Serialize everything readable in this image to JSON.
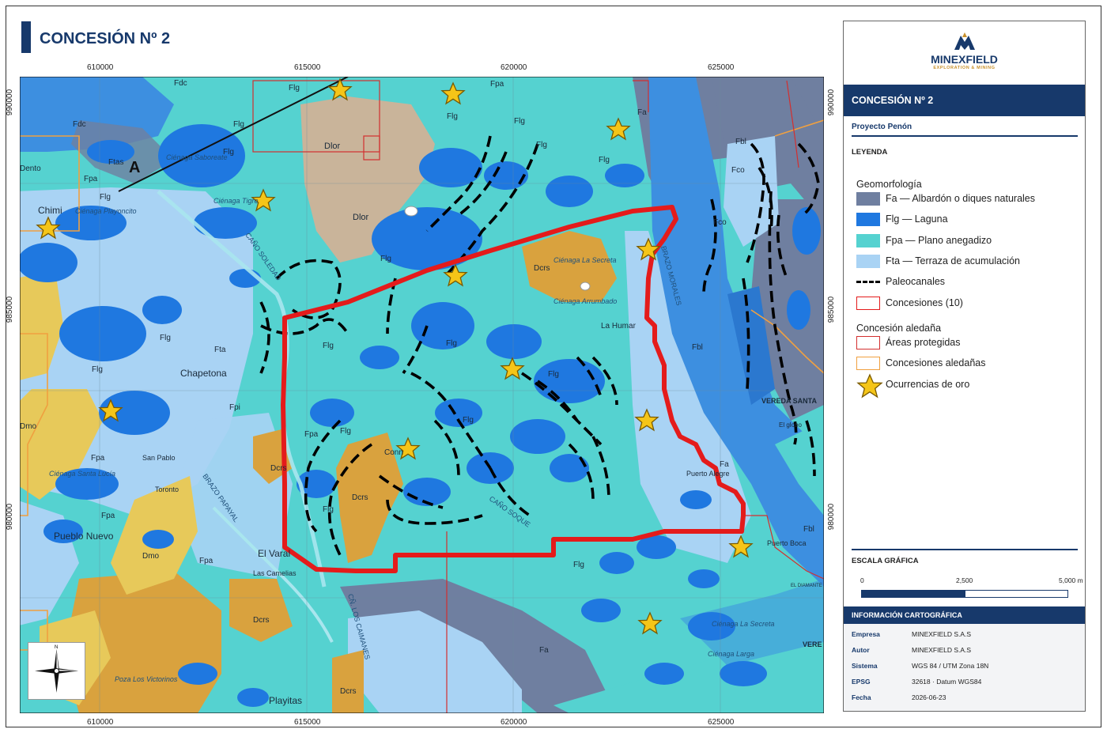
{
  "title": "CONCESIÓN Nº 2",
  "coords": {
    "x_ticks": [
      "610000",
      "615000",
      "620000",
      "625000"
    ],
    "y_ticks": [
      "990000",
      "985000",
      "980000"
    ]
  },
  "colors": {
    "fa": "#6f7fa0",
    "flg": "#1f78e0",
    "fpa": "#55d2d0",
    "fta": "#a9d3f4",
    "dlor": "#c9b49a",
    "dcrs": "#d9a23e",
    "dmo": "#e7c95a",
    "river": "#3d8fe0",
    "concession": "#e41b1b",
    "protected": "#d32f2f",
    "neighbor": "#f0a040",
    "star": "#f5c518",
    "brand": "#17396b",
    "brand_accent": "#c8912c"
  },
  "map_labels": {
    "fdc1": "Fdc",
    "fdc2": "Fdc",
    "a_label": "A",
    "ftas": "Ftas",
    "fpa_nw": "Fpa",
    "dento": "Dento",
    "chimi": "Chimi",
    "cienaga_playoncito": "Ciénaga Playoncito",
    "cienaga_saboreate": "Ciénaga Saboreate",
    "cienaga_tigre": "Ciénaga Tigre",
    "cano_soledad": "CAÑO SOLEDAD",
    "dlor1": "Dlor",
    "dlor2": "Dlor",
    "flg_a": "Flg",
    "flg_b": "Flg",
    "flg_c": "Flg",
    "flg_d": "Flg",
    "flg_e": "Flg",
    "flg_f": "Flg",
    "flg_g": "Flg",
    "flg_h": "Flg",
    "flg_i": "Flg",
    "flg_j": "Flg",
    "flg_k": "Flg",
    "flg_l": "Flg",
    "flg_m": "Flg",
    "flg_n": "Flg",
    "flg_o": "Flg",
    "flg_p": "Flg",
    "flg_q": "Flg",
    "flg_r": "Flg",
    "fpa_top": "Fpa",
    "fa_top": "Fa",
    "fbl1": "Fbl",
    "fco1": "Fco",
    "fco2": "Fco",
    "fbl2": "Fbl",
    "fbl3": "Fbl",
    "dcrs1": "Dcrs",
    "cienaga_secreta": "Ciénaga La Secreta",
    "cienaga_arrumbado": "Ciénaga Arrumbado",
    "la_humareda": "La Humar",
    "fta1": "Fta",
    "chapetona": "Chapetona",
    "fpi": "Fpi",
    "cienaga_santa_lucia": "Ciénaga Santa Lucía",
    "san_pablo": "San Pablo",
    "dmo1": "Dmo",
    "dmo2": "Dmo",
    "dcrs2": "Dcrs",
    "dcrs3": "Dcrs",
    "dcrs4": "Dcrs",
    "dcrs5": "Dcrs",
    "fpa_l1": "Fpa",
    "fpa_l2": "Fpa",
    "fpa_l3": "Fpa",
    "toronto": "Toronto",
    "pueblo_nuevo": "Pueblo Nuevo",
    "brazo_papayal": "BRAZO PAPAYAL",
    "el_varal": "El Varal",
    "las_camelias": "Las Camelias",
    "cano_los_caimanes": "CÑ. LOS CAIMANES",
    "pozo_victorinos": "Poza Los Victorinos",
    "playitas": "Playitas",
    "fa_bottom": "Fa",
    "puerto_alegre": "Puerto Alegre",
    "puerto_boca": "Puerto Boca",
    "vereda": "VEREDA SANTA",
    "vere": "VERE",
    "cano_soque": "CAÑO SOQUE",
    "bocas_arenal": "BRAZO MORALES",
    "conn": "Conn",
    "fpa_mid": "Fpa",
    "cienaga_secreta2": "Ciénaga La Secreta",
    "cienaga_larga": "Ciénaga Larga",
    "el_diamante": "EL DIAMANTE",
    "fa_right": "Fa",
    "el_globo": "El globo"
  },
  "sidebar": {
    "logo_text": "MINEXFIELD",
    "logo_sub": "EXPLORATION & MINING",
    "header": "CONCESIÓN Nº 2",
    "project": "Proyecto Penón",
    "legend_title": "LEYENDA",
    "group1": "Geomorfología",
    "legend": [
      {
        "label": "Fa — Albardón o diques naturales",
        "type": "fill",
        "color": "#6f7fa0"
      },
      {
        "label": "Flg — Laguna",
        "type": "fill",
        "color": "#1f78e0"
      },
      {
        "label": "Fpa — Plano anegadizo",
        "type": "fill",
        "color": "#55d2d0"
      },
      {
        "label": "Fta — Terraza de acumulación",
        "type": "fill",
        "color": "#a9d3f4"
      },
      {
        "label": "Paleocanales",
        "type": "dash",
        "color": "#000000"
      },
      {
        "label": "Concesiones (10)",
        "type": "outline",
        "color": "#e41b1b"
      }
    ],
    "group2": "Concesión aledaña",
    "legend2": [
      {
        "label": "Áreas protegidas",
        "type": "outline",
        "color": "#d32f2f"
      },
      {
        "label": "Concesiones aledañas",
        "type": "outline",
        "color": "#f0a040"
      },
      {
        "label": "Ocurrencias de oro",
        "type": "star",
        "color": "#f5c518"
      }
    ],
    "scale_title": "ESCALA GRÁFICA",
    "scale_labels": [
      "0",
      "2,500",
      "5,000 m"
    ],
    "info_header": "INFORMACIÓN CARTOGRÁFICA",
    "info": [
      {
        "k": "Empresa",
        "v": "MINEXFIELD S.A.S"
      },
      {
        "k": "Autor",
        "v": "MINEXFIELD S.A.S"
      },
      {
        "k": "Sistema",
        "v": "WGS 84 / UTM Zona 18N"
      },
      {
        "k": "EPSG",
        "v": "32618  ·  Datum WGS84"
      },
      {
        "k": "Fecha",
        "v": "2026-06-23"
      }
    ]
  }
}
